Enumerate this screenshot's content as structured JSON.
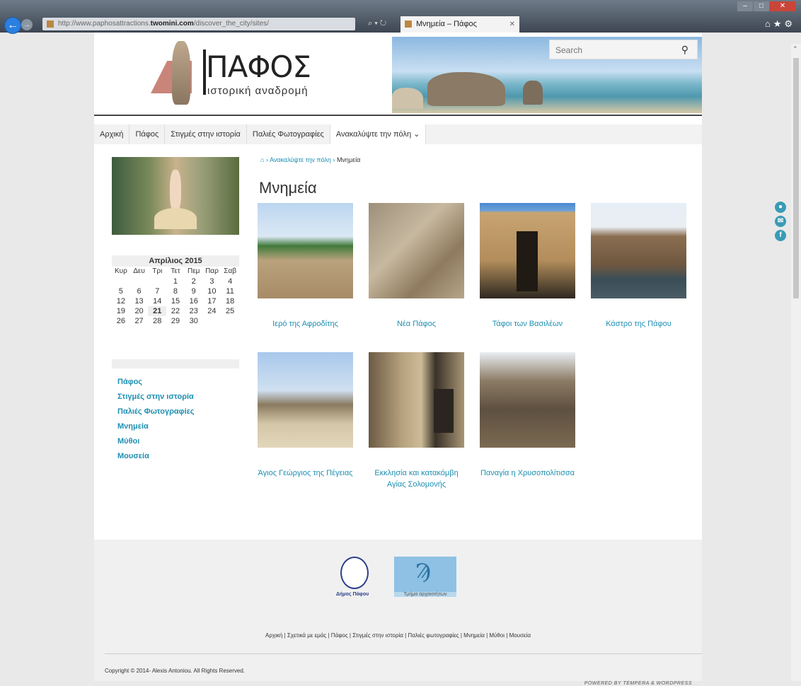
{
  "browser": {
    "url_prefix": "http://www.paphosattractions.",
    "url_domain": "twomini.com",
    "url_path": "/discover_the_city/sites/",
    "tab_title": "Μνημεία – Πάφος"
  },
  "header": {
    "logo_title": "ΠΑΦΟΣ",
    "logo_subtitle": "ιστορική αναδρομή",
    "search_placeholder": "Search"
  },
  "nav": {
    "items": [
      "Αρχική",
      "Πάφος",
      "Στιγμές στην ιστορία",
      "Παλιές Φωτογραφίες",
      "Ανακαλύψτε την πόλη ⌄"
    ]
  },
  "calendar": {
    "month": "Απρίλιος 2015",
    "days": [
      "Κυρ",
      "Δευ",
      "Τρι",
      "Τετ",
      "Πεμ",
      "Παρ",
      "Σαβ"
    ],
    "weeks": [
      [
        "",
        "",
        "",
        "1",
        "2",
        "3",
        "4"
      ],
      [
        "5",
        "6",
        "7",
        "8",
        "9",
        "10",
        "11"
      ],
      [
        "12",
        "13",
        "14",
        "15",
        "16",
        "17",
        "18"
      ],
      [
        "19",
        "20",
        "21",
        "22",
        "23",
        "24",
        "25"
      ],
      [
        "26",
        "27",
        "28",
        "29",
        "30",
        "",
        ""
      ]
    ],
    "today": "21"
  },
  "sidebar": {
    "links": [
      "Πάφος",
      "Στιγμές στην ιστορία",
      "Παλιές Φωτογραφίες",
      "Μνημεία",
      "Μύθοι",
      "Μουσεία"
    ]
  },
  "breadcrumb": {
    "home_icon": "home-icon",
    "parent": "Ανακαλύψτε την πόλη",
    "current": "Μνημεία",
    "sep": "›"
  },
  "main": {
    "title": "Μνημεία",
    "cards": [
      "Ιερό της Αφροδίτης",
      "Νέα Πάφος",
      "Τάφοι των Βασιλέων",
      "Κάστρο της Πάφου",
      "Άγιος Γεώργιος της Πέγειας",
      "Εκκλησία και κατακόμβη Αγίας Σολομονής",
      "Παναγία η Χρυσοπολίτισσα"
    ]
  },
  "footer": {
    "logo1_caption": "Δήμος Πάφου",
    "logo2_caption": "Τμήμα αρχαιοτήτων",
    "links": "Αρχική | Σχετικά με εμάς | Πάφος | Στιγμές στην ιστορία | Παλιές φωτογραφίες | Μνημεία | Μύθοι | Μουσεία",
    "copyright": "Copyright © 2014- Alexis Antoniou. All Rights Reserved.",
    "powered": "POWERED BY TEMPERA & WORDPRESS"
  },
  "colors": {
    "link": "#1e8fb1",
    "accent_logo": "#c9857a"
  }
}
